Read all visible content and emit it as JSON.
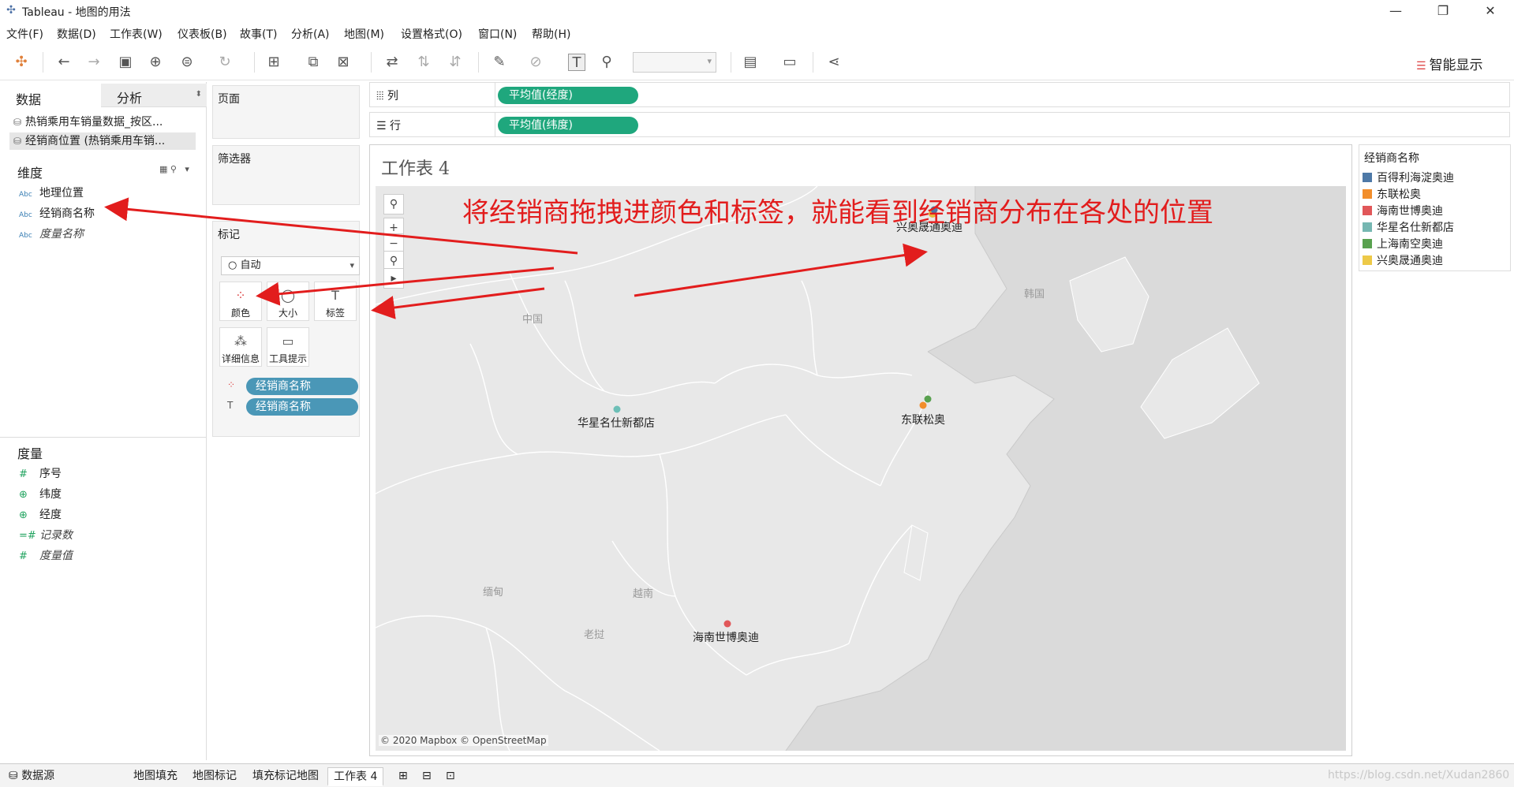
{
  "app": {
    "title": "Tableau - 地图的用法"
  },
  "menu": [
    "文件(F)",
    "数据(D)",
    "工作表(W)",
    "仪表板(B)",
    "故事(T)",
    "分析(A)",
    "地图(M)",
    "设置格式(O)",
    "窗口(N)",
    "帮助(H)"
  ],
  "toolbar": {
    "show_me": "智能显示"
  },
  "left": {
    "tab_data": "数据",
    "tab_analysis": "分析",
    "sources": [
      "热销乘用车销量数据_按区...",
      "经销商位置 (热销乘用车销..."
    ],
    "dimensions_label": "维度",
    "dimensions": [
      "地理位置",
      "经销商名称",
      "度量名称"
    ],
    "measures_label": "度量",
    "measures": [
      "序号",
      "纬度",
      "经度",
      "记录数",
      "度量值"
    ]
  },
  "shelves": {
    "pages": "页面",
    "filters": "筛选器",
    "marks": "标记",
    "mark_type": "自动",
    "buttons": [
      "颜色",
      "大小",
      "标签",
      "详细信息",
      "工具提示"
    ],
    "mark_pills": [
      "经销商名称",
      "经销商名称"
    ],
    "columns_label": "列",
    "rows_label": "行",
    "columns_pill": "平均值(经度)",
    "rows_pill": "平均值(纬度)"
  },
  "sheet": {
    "title": "工作表 4",
    "annotation": "将经销商拖拽进颜色和标签，就能看到经销商分布在各处的位置",
    "copyright": "© 2020 Mapbox © OpenStreetMap",
    "country_labels": [
      "中国",
      "韩国",
      "缅甸",
      "越南",
      "老挝"
    ],
    "points": [
      {
        "label": "兴奥晟通奥迪",
        "color": "#eab73a"
      },
      {
        "label": "华星名仕新都店",
        "color": "#6dbfb7"
      },
      {
        "label": "东联松奥",
        "color": "#f28e2b"
      },
      {
        "label": "海南世博奥迪",
        "color": "#e15759"
      },
      {
        "label": "",
        "color": "#59a14f"
      },
      {
        "label": "",
        "color": "#4e79a7"
      }
    ]
  },
  "legend": {
    "title": "经销商名称",
    "items": [
      {
        "label": "百得利海淀奥迪",
        "color": "#4e79a7"
      },
      {
        "label": "东联松奥",
        "color": "#f28e2b"
      },
      {
        "label": "海南世博奥迪",
        "color": "#e15759"
      },
      {
        "label": "华星名仕新都店",
        "color": "#76b7b2"
      },
      {
        "label": "上海南空奥迪",
        "color": "#59a14f"
      },
      {
        "label": "兴奥晟通奥迪",
        "color": "#edc948"
      }
    ]
  },
  "bottom_tabs": [
    "数据源",
    "地图填充",
    "地图标记",
    "填充标记地图",
    "工作表 4"
  ],
  "watermark": "https://blog.csdn.net/Xudan2860"
}
